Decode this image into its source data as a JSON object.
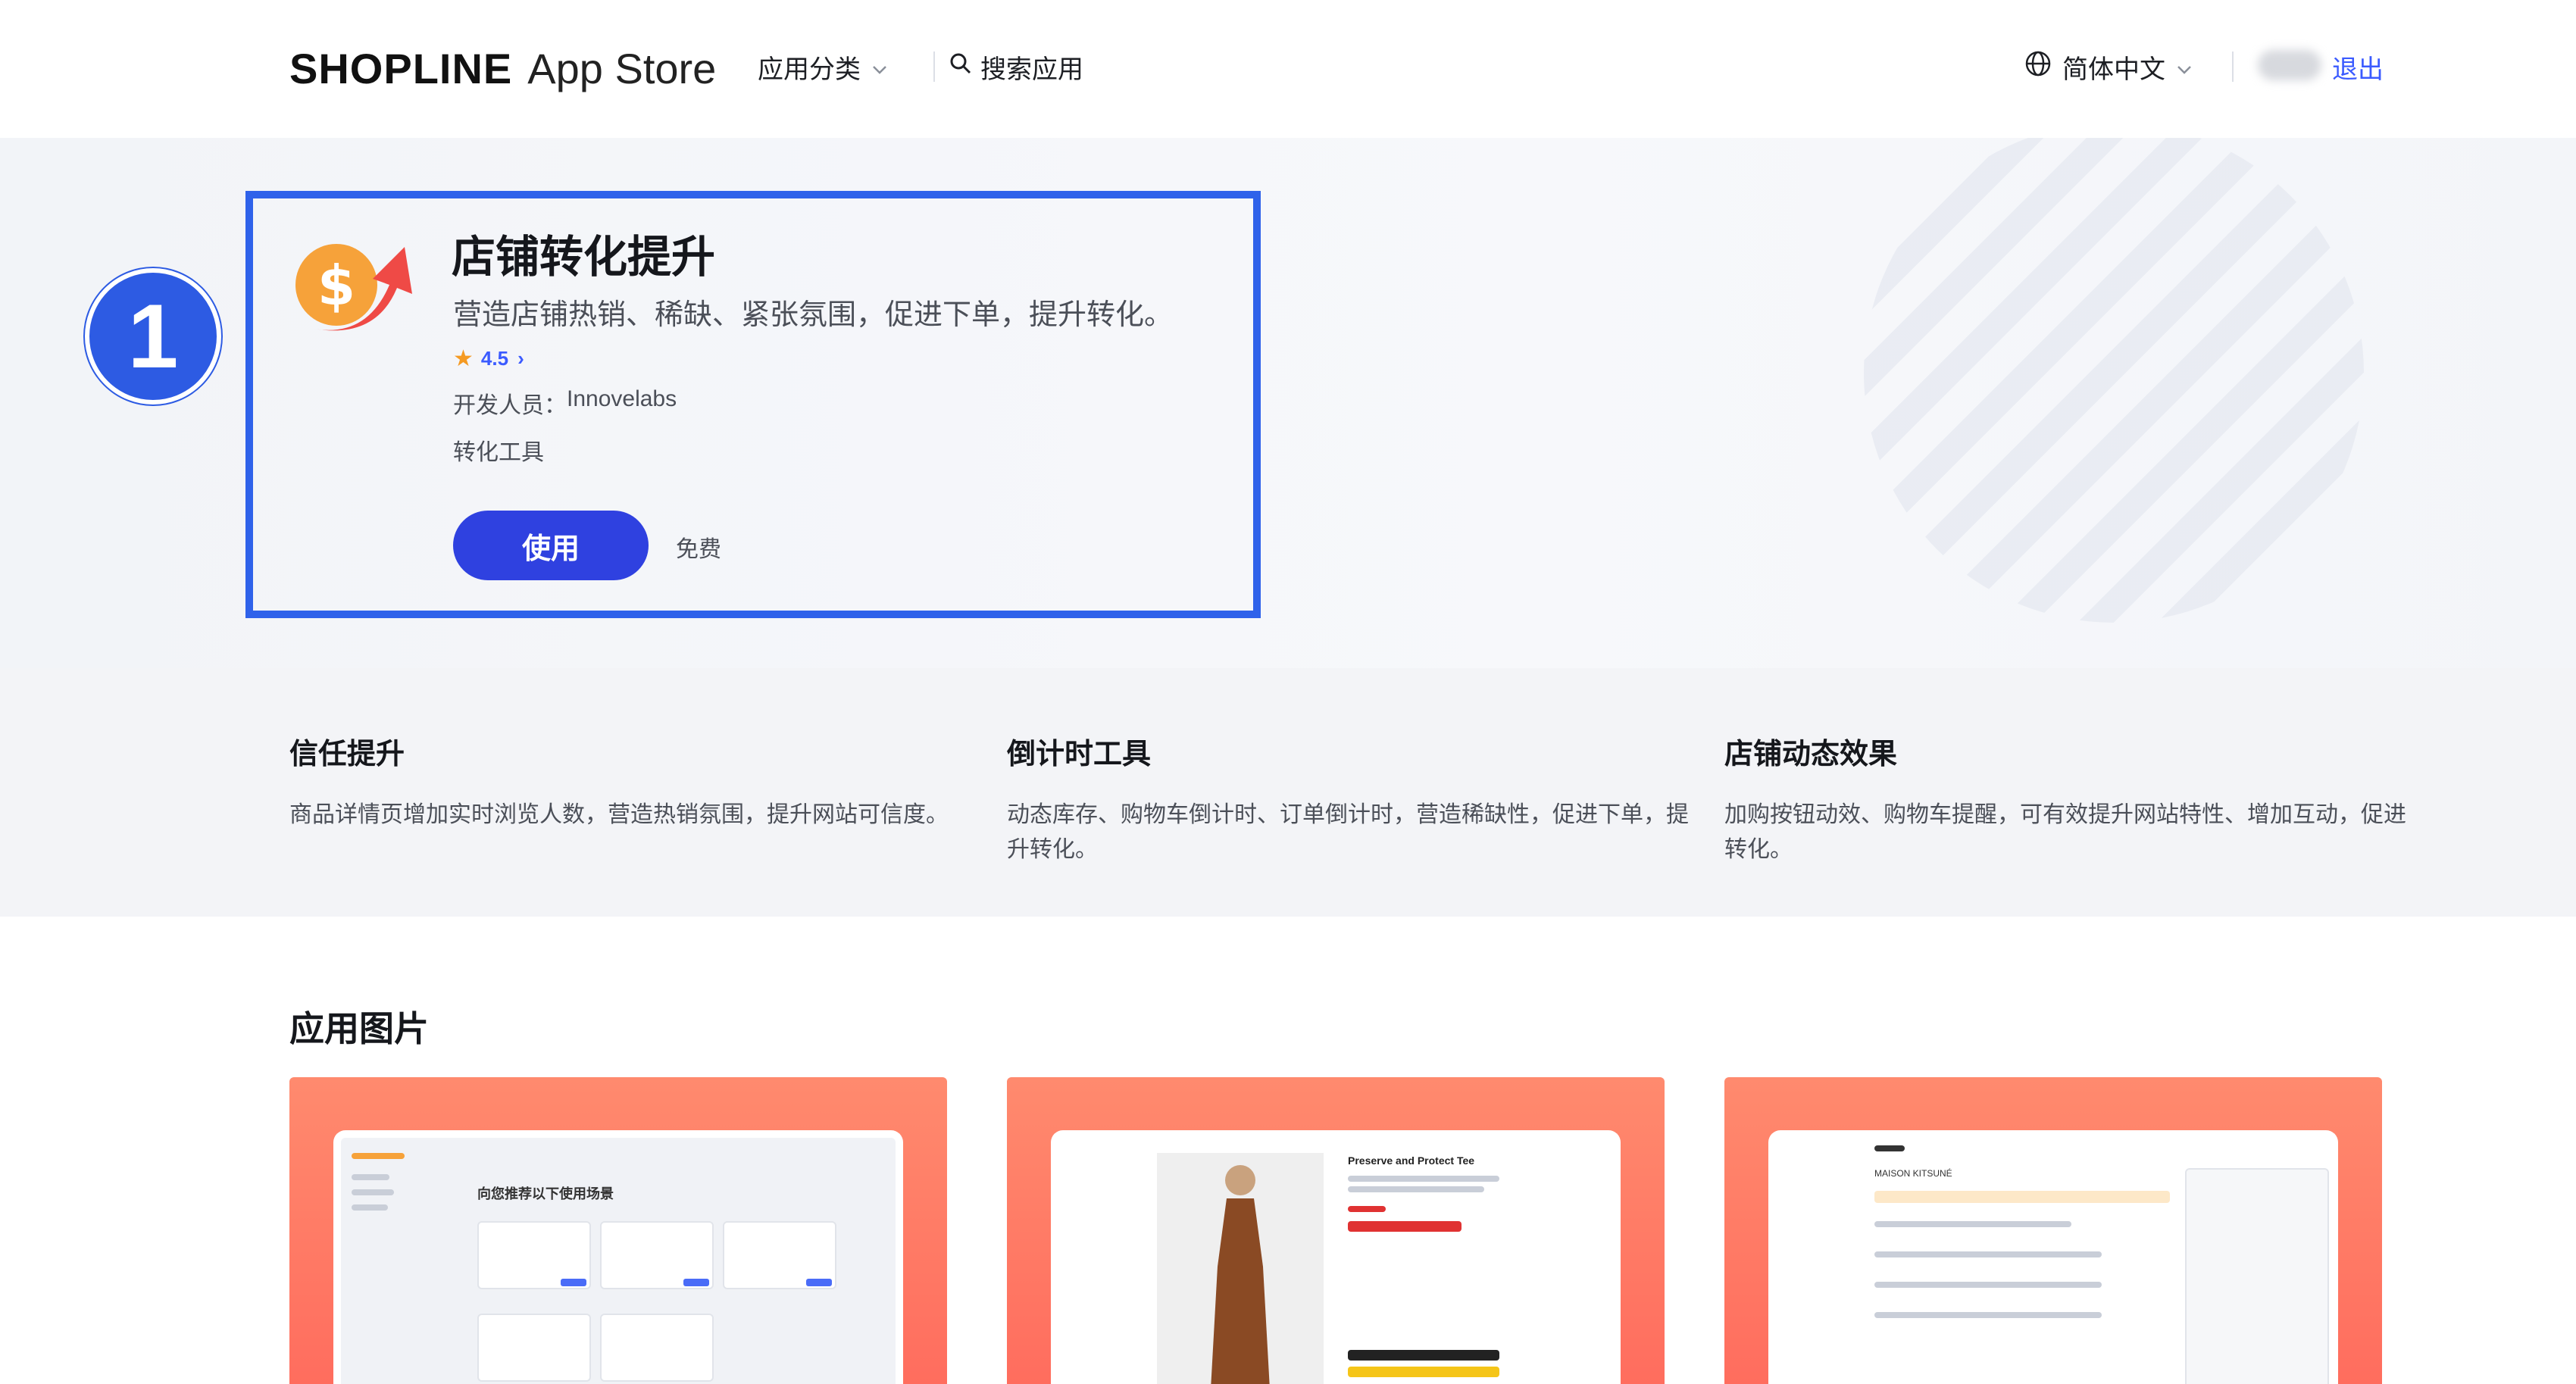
{
  "header": {
    "logo_brand": "SHOPLINE",
    "logo_app": "App Store",
    "nav_categories": "应用分类",
    "nav_search": "搜索应用",
    "language": "简体中文",
    "logout": "退出"
  },
  "hero": {
    "step_badge": "1",
    "title": "店铺转化提升",
    "description": "营造店铺热销、稀缺、紧张氛围，促进下单，提升转化。",
    "rating": "4.5",
    "developer_label": "开发人员：",
    "developer_name": "Innovelabs",
    "category": "转化工具",
    "use_button": "使用",
    "price": "免费"
  },
  "features": [
    {
      "title": "信任提升",
      "desc": "商品详情页增加实时浏览人数，营造热销氛围，提升网站可信度。"
    },
    {
      "title": "倒计时工具",
      "desc": "动态库存、购物车倒计时、订单倒计时，营造稀缺性，促进下单，提升转化。"
    },
    {
      "title": "店铺动态效果",
      "desc": "加购按钮动效、购物车提醒，可有效提升网站特性、增加互动，促进转化。"
    }
  ],
  "gallery": {
    "title": "应用图片",
    "shots": [
      {
        "caption": "向您推荐以下使用场景"
      },
      {
        "caption": "Preserve and Protect Tee"
      },
      {
        "caption": "MAISON KITSUNÉ"
      }
    ]
  },
  "colors": {
    "accent": "#2f41e0",
    "link": "#3b5bff",
    "highlight_border": "#2f62ea",
    "star": "#f59a23",
    "gallery_bg": "#ff7a64"
  }
}
